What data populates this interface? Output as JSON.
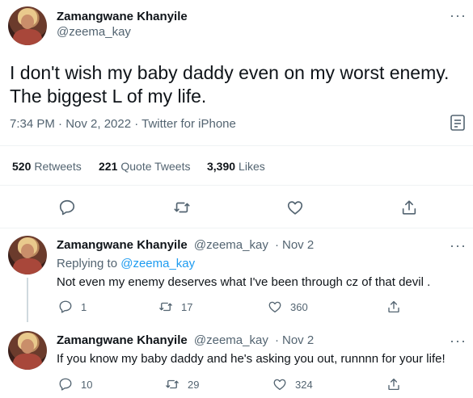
{
  "main_tweet": {
    "author_name": "Zamangwane Khanyile",
    "author_handle": "@zeema_kay",
    "more": "···",
    "text_line1": "I don't wish my baby daddy even on my worst enemy.",
    "text_line2": "The biggest L of my life.",
    "meta": "7:34 PM · Nov 2, 2022 · Twitter for iPhone",
    "stats": {
      "retweets_count": "520",
      "retweets_label": "Retweets",
      "quotes_count": "221",
      "quotes_label": "Quote Tweets",
      "likes_count": "3,390",
      "likes_label": "Likes"
    }
  },
  "replies": [
    {
      "author_name": "Zamangwane Khanyile",
      "author_handle": "@zeema_kay",
      "date": "Nov 2",
      "replying_prefix": "Replying to",
      "replying_to": "@zeema_kay",
      "text": "Not even my enemy deserves what I've been through cz of that devil .",
      "reply_count": "1",
      "retweet_count": "17",
      "like_count": "360"
    },
    {
      "author_name": "Zamangwane Khanyile",
      "author_handle": "@zeema_kay",
      "date": "Nov 2",
      "text": "If you know my baby daddy and he's asking you out, runnnn for your life!",
      "reply_count": "10",
      "retweet_count": "29",
      "like_count": "324"
    }
  ],
  "icons": {
    "reply": "reply-icon",
    "retweet": "retweet-icon",
    "like": "heart-icon",
    "share": "share-icon",
    "analytics": "analytics-icon",
    "more": "more-icon"
  }
}
